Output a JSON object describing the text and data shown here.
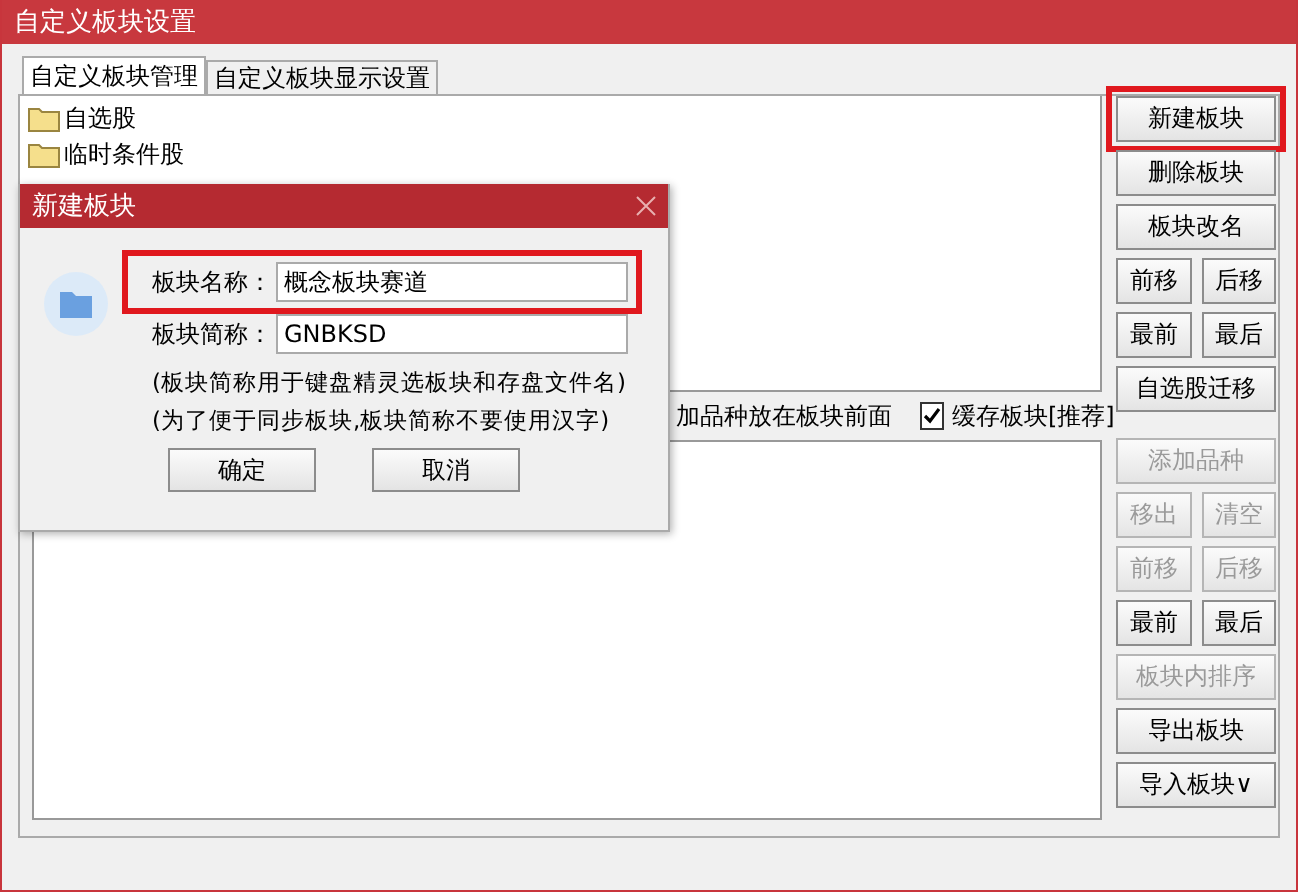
{
  "window": {
    "title": "自定义板块设置"
  },
  "tabs": [
    {
      "label": "自定义板块管理",
      "selected": true
    },
    {
      "label": "自定义板块显示设置",
      "selected": false
    }
  ],
  "block_tree": {
    "items": [
      {
        "label": "自选股"
      },
      {
        "label": "临时条件股"
      }
    ]
  },
  "block_buttons": [
    {
      "buttons": [
        {
          "label": "新建板块",
          "disabled": false,
          "highlighted": true
        }
      ]
    },
    {
      "buttons": [
        {
          "label": "删除板块",
          "disabled": false,
          "highlighted": false
        }
      ]
    },
    {
      "buttons": [
        {
          "label": "板块改名",
          "disabled": false,
          "highlighted": false
        }
      ]
    },
    {
      "buttons": [
        {
          "label": "前移",
          "disabled": false,
          "highlighted": false
        },
        {
          "label": "后移",
          "disabled": false,
          "highlighted": false
        }
      ]
    },
    {
      "buttons": [
        {
          "label": "最前",
          "disabled": false,
          "highlighted": false
        },
        {
          "label": "最后",
          "disabled": false,
          "highlighted": false
        }
      ]
    },
    {
      "buttons": [
        {
          "label": "自选股迁移",
          "disabled": false,
          "highlighted": false
        }
      ]
    }
  ],
  "options": [
    {
      "kind": "text",
      "label": "加品种放在板块前面"
    },
    {
      "kind": "checkbox",
      "label": "缓存板块[推荐]",
      "checked": true
    }
  ],
  "stock_buttons": [
    {
      "buttons": [
        {
          "label": "添加品种",
          "disabled": true,
          "highlighted": false
        }
      ]
    },
    {
      "buttons": [
        {
          "label": "移出",
          "disabled": true,
          "highlighted": false
        },
        {
          "label": "清空",
          "disabled": true,
          "highlighted": false
        }
      ]
    },
    {
      "buttons": [
        {
          "label": "前移",
          "disabled": true,
          "highlighted": false
        },
        {
          "label": "后移",
          "disabled": true,
          "highlighted": false
        }
      ]
    },
    {
      "buttons": [
        {
          "label": "最前",
          "disabled": false,
          "highlighted": false
        },
        {
          "label": "最后",
          "disabled": false,
          "highlighted": false
        }
      ]
    },
    {
      "buttons": [
        {
          "label": "板块内排序",
          "disabled": true,
          "highlighted": false
        }
      ]
    },
    {
      "buttons": [
        {
          "label": "导出板块",
          "disabled": false,
          "highlighted": false
        }
      ]
    },
    {
      "buttons": [
        {
          "label": "导入板块∨",
          "disabled": false,
          "highlighted": false
        }
      ]
    }
  ],
  "dialog": {
    "title": "新建板块",
    "fields": [
      {
        "label": "板块名称：",
        "value": "概念板块赛道",
        "highlighted": true
      },
      {
        "label": "板块简称：",
        "value": "GNBKSD",
        "highlighted": false
      }
    ],
    "notes": [
      "(板块简称用于键盘精灵选板块和存盘文件名)",
      "(为了便于同步板块,板块简称不要使用汉字)"
    ],
    "buttons": [
      "确定",
      "取消"
    ]
  }
}
